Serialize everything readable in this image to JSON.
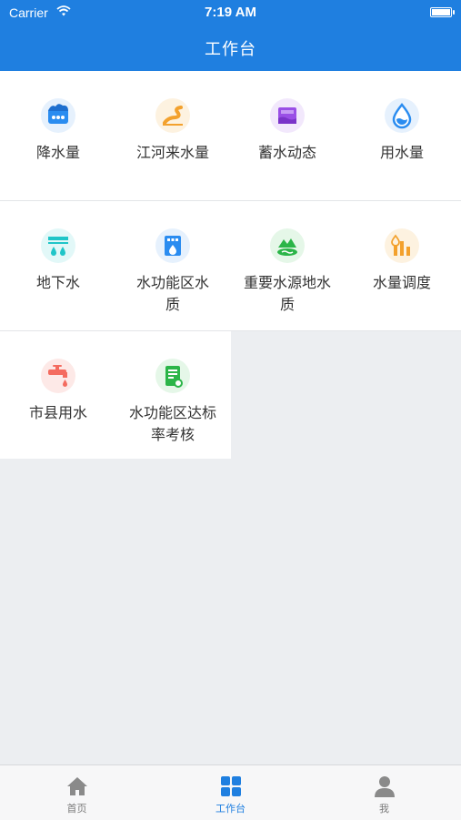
{
  "status_bar": {
    "carrier": "Carrier",
    "time": "7:19 AM"
  },
  "header": {
    "title": "工作台"
  },
  "grid": {
    "items": [
      {
        "label": "降水量",
        "icon": "rain-cloud-icon",
        "color": "#2a8cf0"
      },
      {
        "label": "江河来水量",
        "icon": "river-icon",
        "color": "#f3a12d"
      },
      {
        "label": "蓄水动态",
        "icon": "reservoir-icon",
        "color": "#9a4fe6"
      },
      {
        "label": "用水量",
        "icon": "water-drop-icon",
        "color": "#2a8cf0"
      },
      {
        "label": "地下水",
        "icon": "groundwater-icon",
        "color": "#20c5c8"
      },
      {
        "label": "水功能区水质",
        "icon": "water-quality-meter-icon",
        "color": "#2a8cf0"
      },
      {
        "label": "重要水源地水质",
        "icon": "water-source-icon",
        "color": "#2bb548"
      },
      {
        "label": "水量调度",
        "icon": "water-dispatch-icon",
        "color": "#f3a12d"
      },
      {
        "label": "市县用水",
        "icon": "faucet-icon",
        "color": "#f46b5f"
      },
      {
        "label": "水功能区达标率考核",
        "icon": "assessment-document-icon",
        "color": "#2bb548"
      }
    ]
  },
  "tabbar": {
    "tabs": [
      {
        "label": "首页",
        "icon": "home-icon",
        "active": false
      },
      {
        "label": "工作台",
        "icon": "grid-icon",
        "active": true
      },
      {
        "label": "我",
        "icon": "user-icon",
        "active": false
      }
    ]
  }
}
